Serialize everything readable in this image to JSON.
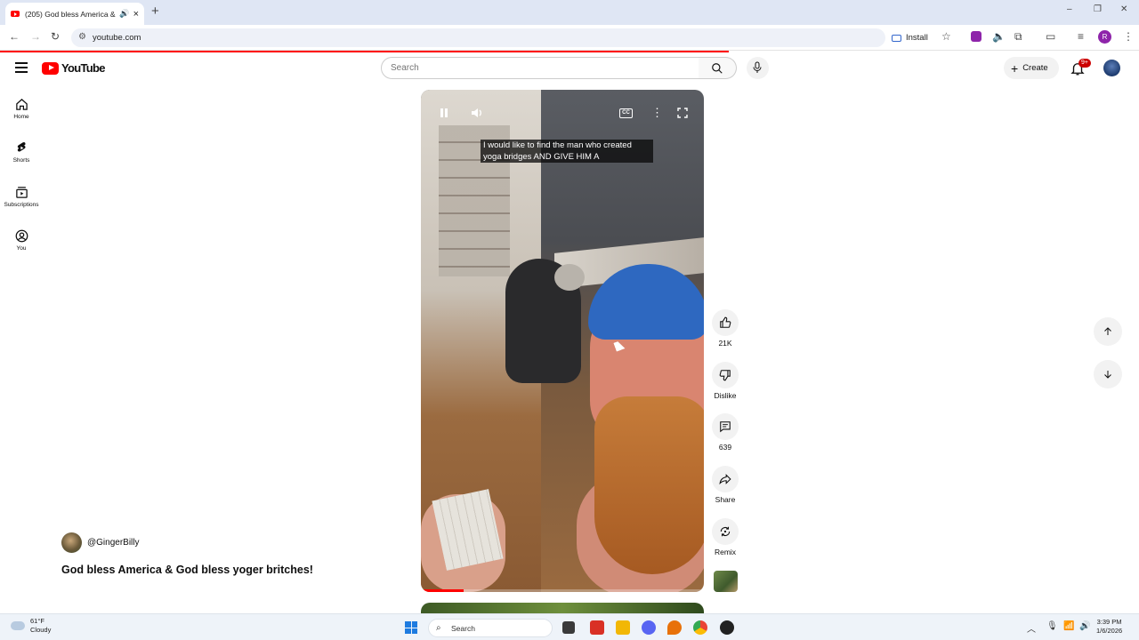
{
  "browser": {
    "tab_title": "(205) God bless America &",
    "new_tab": "+",
    "url": "youtube.com",
    "install_label": "Install",
    "profile_initial": "R",
    "window_controls": [
      "–",
      "❐",
      "✕"
    ]
  },
  "youtube": {
    "logo_text": "YouTube",
    "search_placeholder": "Search",
    "create_label": "Create",
    "notifications_badge": "9+"
  },
  "guide": {
    "items": [
      {
        "label": "Home",
        "icon": "home-icon"
      },
      {
        "label": "Shorts",
        "icon": "shorts-icon"
      },
      {
        "label": "Subscriptions",
        "icon": "subscriptions-icon"
      },
      {
        "label": "You",
        "icon": "you-icon"
      }
    ]
  },
  "short": {
    "channel": "@GingerBilly",
    "title": "God bless America & God bless yoger britches!",
    "caption": "I would like to find the man who created yoga bridges AND GIVE HIM A",
    "cc_label": "CC",
    "progress": 0.15,
    "actions": {
      "like_count": "21K",
      "dislike_label": "Dislike",
      "comments_count": "639",
      "share_label": "Share",
      "remix_label": "Remix"
    }
  },
  "taskbar": {
    "temp": "61°F",
    "condition": "Cloudy",
    "search_label": "Search",
    "time": "3:39 PM",
    "date": "1/6/2026"
  },
  "colors": {
    "brand_red": "#ff0000",
    "like_blue": "#3366cc"
  }
}
